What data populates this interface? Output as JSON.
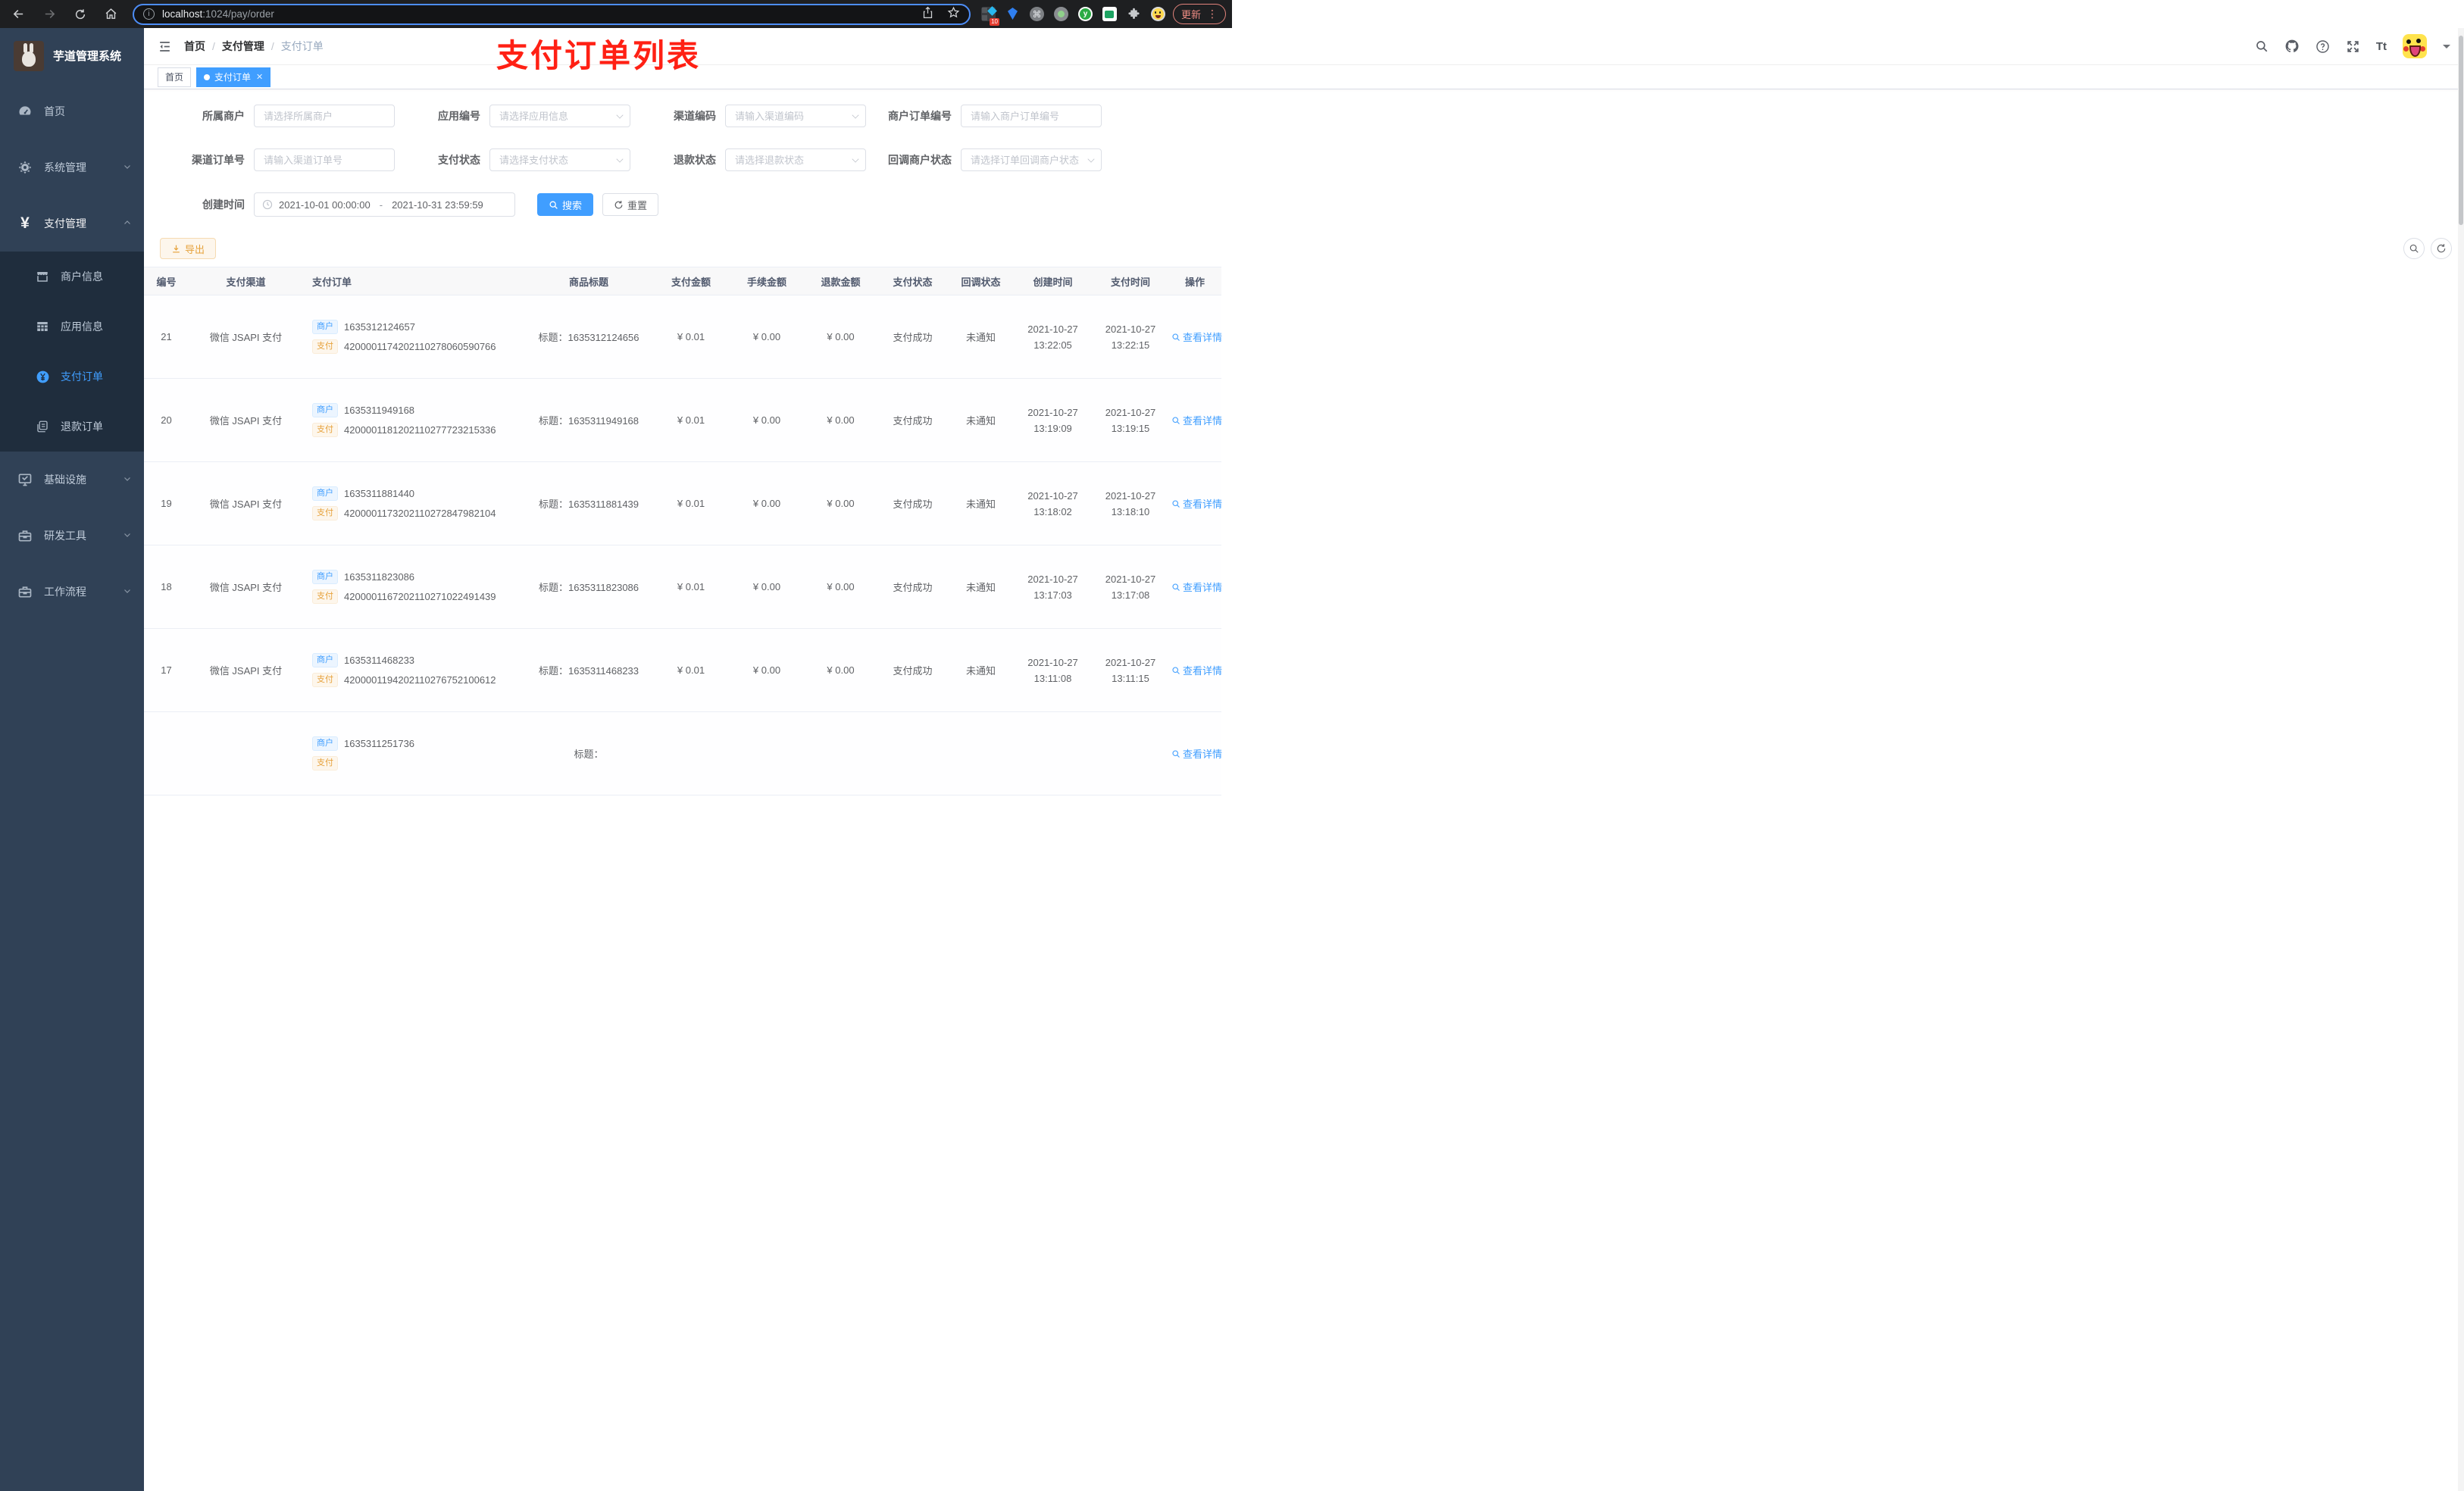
{
  "theme": {
    "accent": "#409eff",
    "warning": "#e6a23c",
    "sidebar_bg": "#304156",
    "submenu_bg": "#1f2d3d",
    "annotation_red": "#ff2014"
  },
  "browser": {
    "url_host": "localhost",
    "url_rest": ":1024/pay/order",
    "extension_badge": "10",
    "update_label": "更新"
  },
  "sidebar": {
    "title": "芋道管理系统",
    "items": [
      {
        "label": "首页"
      },
      {
        "label": "系统管理"
      },
      {
        "label": "支付管理"
      },
      {
        "label": "商户信息"
      },
      {
        "label": "应用信息"
      },
      {
        "label": "支付订单"
      },
      {
        "label": "退款订单"
      },
      {
        "label": "基础设施"
      },
      {
        "label": "研发工具"
      },
      {
        "label": "工作流程"
      }
    ]
  },
  "navbar": {
    "breadcrumb": [
      "首页",
      "支付管理",
      "支付订单"
    ],
    "separator": "/",
    "font_size_label": "Tt"
  },
  "annotation": "支付订单列表",
  "tags": [
    {
      "label": "首页",
      "active": false
    },
    {
      "label": "支付订单",
      "active": true
    }
  ],
  "filters": {
    "fields": [
      {
        "label": "所属商户",
        "placeholder": "请选择所属商户",
        "type": "input"
      },
      {
        "label": "应用编号",
        "placeholder": "请选择应用信息",
        "type": "select"
      },
      {
        "label": "渠道编码",
        "placeholder": "请输入渠道编码",
        "type": "select"
      },
      {
        "label": "商户订单编号",
        "placeholder": "请输入商户订单编号",
        "type": "input"
      },
      {
        "label": "渠道订单号",
        "placeholder": "请输入渠道订单号",
        "type": "input"
      },
      {
        "label": "支付状态",
        "placeholder": "请选择支付状态",
        "type": "select"
      },
      {
        "label": "退款状态",
        "placeholder": "请选择退款状态",
        "type": "select"
      },
      {
        "label": "回调商户状态",
        "placeholder": "请选择订单回调商户状态",
        "type": "select"
      }
    ],
    "date": {
      "label": "创建时间",
      "start": "2021-10-01 00:00:00",
      "dash": "-",
      "end": "2021-10-31 23:59:59"
    },
    "search_label": "搜索",
    "reset_label": "重置"
  },
  "toolbar": {
    "export_label": "导出"
  },
  "table": {
    "columns": [
      "编号",
      "支付渠道",
      "支付订单",
      "商品标题",
      "支付金额",
      "手续金额",
      "退款金额",
      "支付状态",
      "回调状态",
      "创建时间",
      "支付时间",
      "操作"
    ],
    "merchant_tag": "商户",
    "pay_tag": "支付",
    "title_prefix": "标题：",
    "action_label": "查看详情",
    "rows": [
      {
        "id": "21",
        "channel": "微信 JSAPI 支付",
        "merchant_no": "1635312124657",
        "pay_no": "4200001174202110278060590766",
        "title": "1635312124656",
        "amount": "¥ 0.01",
        "fee": "¥ 0.00",
        "refund": "¥ 0.00",
        "status": "支付成功",
        "notify": "未通知",
        "create_date": "2021-10-27",
        "create_time": "13:22:05",
        "pay_date": "2021-10-27",
        "pay_time": "13:22:15"
      },
      {
        "id": "20",
        "channel": "微信 JSAPI 支付",
        "merchant_no": "1635311949168",
        "pay_no": "4200001181202110277723215336",
        "title": "1635311949168",
        "amount": "¥ 0.01",
        "fee": "¥ 0.00",
        "refund": "¥ 0.00",
        "status": "支付成功",
        "notify": "未通知",
        "create_date": "2021-10-27",
        "create_time": "13:19:09",
        "pay_date": "2021-10-27",
        "pay_time": "13:19:15"
      },
      {
        "id": "19",
        "channel": "微信 JSAPI 支付",
        "merchant_no": "1635311881440",
        "pay_no": "4200001173202110272847982104",
        "title": "1635311881439",
        "amount": "¥ 0.01",
        "fee": "¥ 0.00",
        "refund": "¥ 0.00",
        "status": "支付成功",
        "notify": "未通知",
        "create_date": "2021-10-27",
        "create_time": "13:18:02",
        "pay_date": "2021-10-27",
        "pay_time": "13:18:10"
      },
      {
        "id": "18",
        "channel": "微信 JSAPI 支付",
        "merchant_no": "1635311823086",
        "pay_no": "4200001167202110271022491439",
        "title": "1635311823086",
        "amount": "¥ 0.01",
        "fee": "¥ 0.00",
        "refund": "¥ 0.00",
        "status": "支付成功",
        "notify": "未通知",
        "create_date": "2021-10-27",
        "create_time": "13:17:03",
        "pay_date": "2021-10-27",
        "pay_time": "13:17:08"
      },
      {
        "id": "17",
        "channel": "微信 JSAPI 支付",
        "merchant_no": "1635311468233",
        "pay_no": "4200001194202110276752100612",
        "title": "1635311468233",
        "amount": "¥ 0.01",
        "fee": "¥ 0.00",
        "refund": "¥ 0.00",
        "status": "支付成功",
        "notify": "未通知",
        "create_date": "2021-10-27",
        "create_time": "13:11:08",
        "pay_date": "2021-10-27",
        "pay_time": "13:11:15"
      },
      {
        "id": "",
        "channel": "",
        "merchant_no": "1635311251736",
        "pay_no": "",
        "title": "",
        "amount": "",
        "fee": "",
        "refund": "",
        "status": "",
        "notify": "",
        "create_date": "",
        "create_time": "",
        "pay_date": "",
        "pay_time": ""
      }
    ]
  }
}
